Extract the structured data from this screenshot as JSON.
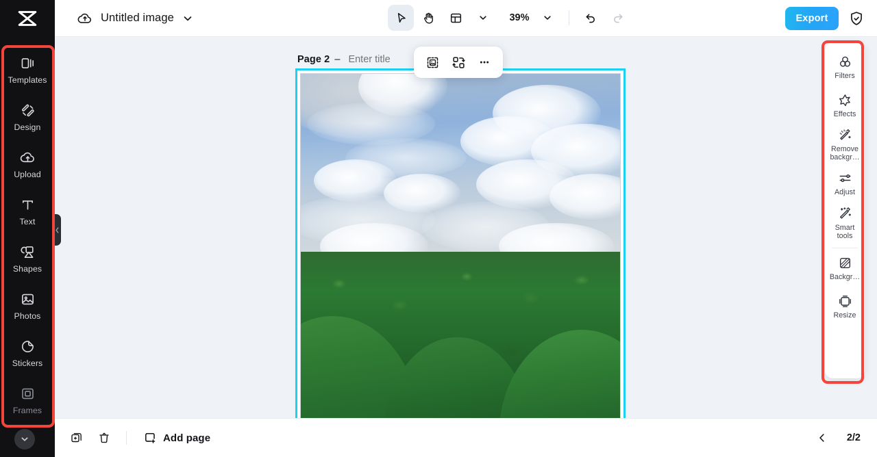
{
  "app": {
    "name": "CapCut",
    "logo_icon": "capcut-logo-icon",
    "accent_red": "#f4453c",
    "accent_cyan": "#1ed0f0",
    "export_gradient_from": "#20b7f0",
    "export_gradient_to": "#2ca2fb",
    "canvas_bg": "#eff2f6",
    "rail_bg": "#111113"
  },
  "topbar": {
    "cloud_icon": "cloud-save-icon",
    "document_title": "Untitled image",
    "title_chevron_icon": "chevron-down-icon",
    "tools": [
      {
        "name": "select-tool",
        "icon": "cursor-arrow-icon",
        "active": true
      },
      {
        "name": "hand-tool",
        "icon": "hand-icon",
        "active": false
      },
      {
        "name": "layout-tool",
        "icon": "layout-panel-icon",
        "active": false
      }
    ],
    "layout_chevron_icon": "chevron-down-icon",
    "zoom_level": "39%",
    "zoom_chevron_icon": "chevron-down-icon",
    "undo_icon": "undo-arrow-icon",
    "redo_icon": "redo-arrow-icon",
    "redo_disabled": true,
    "export_label": "Export",
    "shield_icon": "shield-check-icon"
  },
  "left_rail": {
    "items": [
      {
        "label": "Templates",
        "icon": "templates-icon",
        "faded": false
      },
      {
        "label": "Design",
        "icon": "design-brush-icon",
        "faded": false
      },
      {
        "label": "Upload",
        "icon": "upload-cloud-icon",
        "faded": false
      },
      {
        "label": "Text",
        "icon": "text-t-icon",
        "faded": false
      },
      {
        "label": "Shapes",
        "icon": "shapes-icon",
        "faded": false
      },
      {
        "label": "Photos",
        "icon": "photo-image-icon",
        "faded": false
      },
      {
        "label": "Stickers",
        "icon": "sticker-icon",
        "faded": false
      },
      {
        "label": "Frames",
        "icon": "frame-square-icon",
        "faded": true
      }
    ],
    "collapse_icon": "chevron-down-icon",
    "panel_handle_icon": "collapse-panel-handle-icon"
  },
  "canvas": {
    "page_label": "Page 2",
    "page_dash": "–",
    "page_title_value": "",
    "page_title_placeholder": "Enter title",
    "duplicate_page_icon": "duplicate-image-icon",
    "page_more_icon": "more-horizontal-icon",
    "floating_toolbar": [
      {
        "name": "crop-image-button",
        "icon": "crop-selection-image-icon"
      },
      {
        "name": "replace-image-button",
        "icon": "swap-replace-icon"
      },
      {
        "name": "image-more-button",
        "icon": "more-horizontal-icon"
      }
    ],
    "image_alt": "Chocolate Hills landscape with green jungle and blue cloudy sky",
    "selection_border_color": "#1ed0f0"
  },
  "right_rail": {
    "groups": [
      {
        "items": [
          {
            "label": "Filters",
            "icon": "filters-circles-icon"
          },
          {
            "label": "Effects",
            "icon": "effects-star-icon"
          },
          {
            "label": "Remove backgr…",
            "icon": "remove-background-wand-icon"
          },
          {
            "label": "Adjust",
            "icon": "adjust-sliders-icon"
          },
          {
            "label": "Smart tools",
            "icon": "smart-tools-wand-icon"
          }
        ]
      },
      {
        "items": [
          {
            "label": "Backgr…",
            "icon": "background-swatch-icon"
          },
          {
            "label": "Resize",
            "icon": "resize-frame-icon"
          }
        ]
      }
    ]
  },
  "bottombar": {
    "duplicate_icon": "duplicate-page-icon",
    "delete_icon": "trash-bin-icon",
    "add_page_icon": "add-page-icon",
    "add_page_label": "Add page",
    "prev_page_icon": "chevron-left-icon",
    "page_indicator": "2/2"
  },
  "annotations": {
    "left_box_color": "#f4453c",
    "right_box_color": "#f4453c"
  }
}
